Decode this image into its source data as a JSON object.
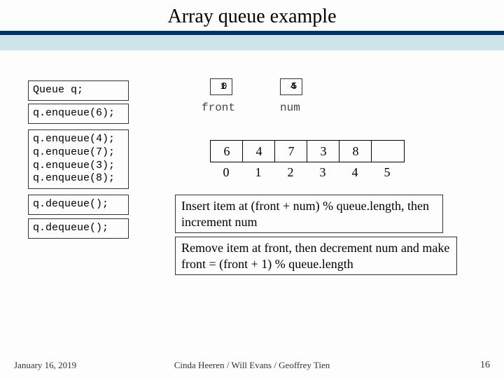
{
  "title": "Array queue example",
  "code": {
    "declare": "Queue q;",
    "enq6": "q.enqueue(6);",
    "enq_block": "q.enqueue(4);\nq.enqueue(7);\nq.enqueue(3);\nq.enqueue(8);",
    "deq1": "q.dequeue();",
    "deq2": "q.dequeue();"
  },
  "state": {
    "front_box": "10",
    "num_box": "45",
    "front_label": "front",
    "num_label": "num"
  },
  "array": {
    "values": [
      "6",
      "4",
      "7",
      "3",
      "8",
      ""
    ],
    "indices": [
      "0",
      "1",
      "2",
      "3",
      "4",
      "5"
    ]
  },
  "notes": {
    "insert": "Insert item at (front + num) % queue.length, then increment num",
    "remove": "Remove item at front, then decrement num and make front = (front + 1) % queue.length"
  },
  "footer": {
    "date": "January 16, 2019",
    "credits": "Cinda Heeren / Will Evans / Geoffrey Tien",
    "page": "16"
  }
}
